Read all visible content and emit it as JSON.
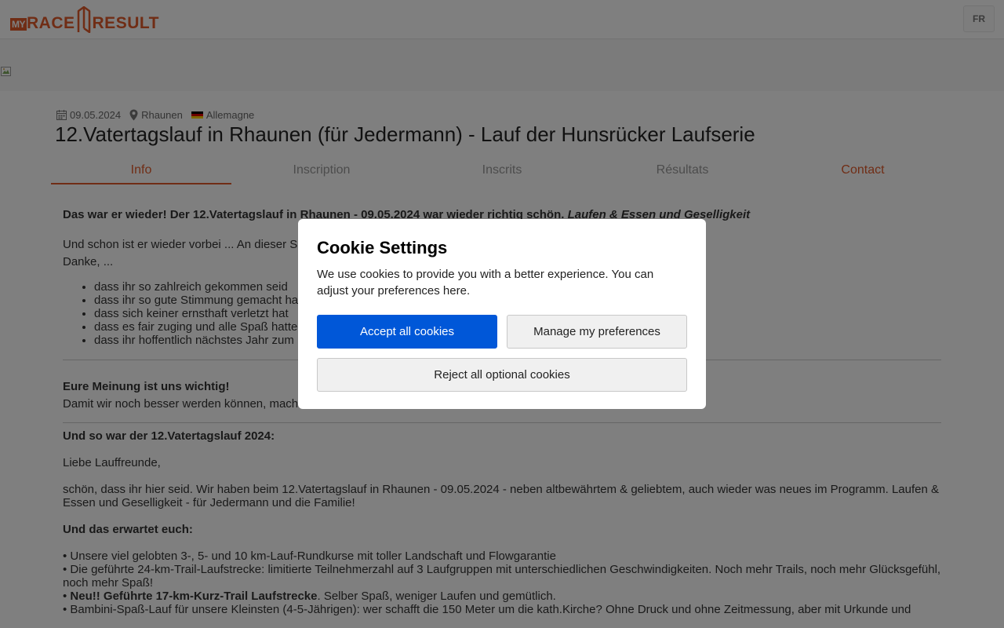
{
  "header": {
    "logo": {
      "my": "MY",
      "race": "RACE",
      "result": "RESULT"
    },
    "language": "FR"
  },
  "event": {
    "date": "09.05.2024",
    "location": "Rhaunen",
    "country": "Allemagne",
    "title": "12.Vatertagslauf in Rhaunen (für Jedermann) - Lauf der Hunsrücker Laufserie",
    "flag_colors": [
      "#000000",
      "#dd0000",
      "#ffce00"
    ]
  },
  "tabs": [
    {
      "label": "Info"
    },
    {
      "label": "Inscription"
    },
    {
      "label": "Inscrits"
    },
    {
      "label": "Résultats"
    },
    {
      "label": "Contact"
    }
  ],
  "content": {
    "headline": "Das war er wieder! Der 12.Vatertagslauf in Rhaunen - 09.05.2024 war wieder richtig schön.",
    "headline_italic": "Laufen & Essen und Geselligkeit",
    "intro": "Und schon ist er wieder vorbei ... An dieser S",
    "thanks": "Danke, ...",
    "thanks_list": [
      "dass ihr so zahlreich gekommen seid",
      "dass ihr so gute Stimmung gemacht ha",
      "dass sich keiner ernsthaft verletzt hat",
      "dass es fair zuging und alle Spaß hatte",
      "dass ihr hoffentlich nächstes Jahr zum"
    ],
    "opinion_heading": "Eure Meinung ist uns wichtig!",
    "opinion_text": "Damit wir noch besser werden können, mach",
    "recap_heading": "Und so war der 12.Vatertagslauf 2024:",
    "greeting": "Liebe Lauffreunde,",
    "welcome": "schön, dass ihr hier seid. Wir haben beim 12.Vatertagslauf in Rhaunen - 09.05.2024 - neben altbewährtem & geliebtem, auch wieder was neues im Programm. Laufen & Essen und Geselligkeit - für Jedermann und die Familie!",
    "expect_heading": "Und das erwartet euch:",
    "bullet1": "• Unsere viel gelobten 3-, 5- und 10 km-Lauf-Rundkurse mit toller Landschaft und Flowgarantie",
    "bullet2": "• Die geführte 24-km-Trail-Laufstrecke: limitierte Teilnehmerzahl auf 3 Laufgruppen mit unterschiedlichen Geschwindigkeiten. Noch mehr Trails, noch mehr Glücksgefühl, noch mehr Spaß!",
    "bullet3_prefix": "• ",
    "bullet3_bold": "Neu!! Geführte 17-km-Kurz-Trail Laufstrecke",
    "bullet3_rest": ". Selber Spaß, weniger Laufen und gemütlich.",
    "bullet4": "• Bambini-Spaß-Lauf für unsere Kleinsten (4-5-Jährigen): wer schafft die 150 Meter um die kath.Kirche? Ohne Druck und ohne Zeitmessung, aber mit Urkunde und"
  },
  "cookie_modal": {
    "title": "Cookie Settings",
    "text": "We use cookies to provide you with a better experience. You can adjust your preferences here.",
    "accept_label": "Accept all cookies",
    "manage_label": "Manage my preferences",
    "reject_label": "Reject all optional cookies"
  },
  "colors": {
    "brand": "#e05a2b",
    "primary_button": "#0057d8"
  },
  "icons": {
    "date": "calendar-icon",
    "location": "map-pin-icon",
    "country": "germany-flag-icon",
    "banner": "broken-image-icon"
  }
}
